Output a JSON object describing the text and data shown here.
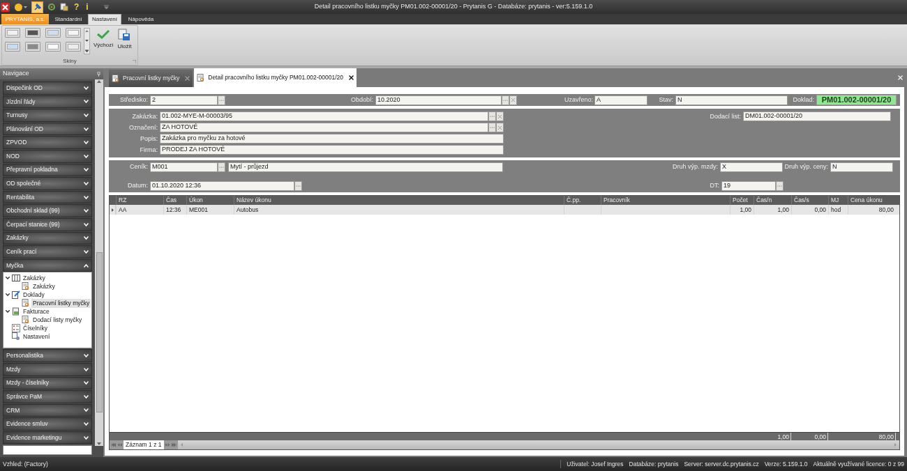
{
  "window": {
    "title": "Detail pracovního listku myčky PM01.002-00001/20 - Prytanis G - Databáze: prytanis - ver:5.159.1.0"
  },
  "quick_access": [
    {
      "kind": "close"
    },
    {
      "kind": "circle"
    },
    {
      "kind": "pin",
      "selected": true
    },
    {
      "kind": "refresh"
    },
    {
      "kind": "doc"
    },
    {
      "kind": "glyph",
      "text": "?"
    },
    {
      "kind": "glyph",
      "text": "i"
    }
  ],
  "ribbon": {
    "tabs": [
      {
        "label": "PRYTANIS, a.s.",
        "kind": "app",
        "selected": false
      },
      {
        "label": "Standardní",
        "kind": "tab",
        "selected": false
      },
      {
        "label": "Nastavení",
        "kind": "tab",
        "selected": true
      },
      {
        "label": "Nápověda",
        "kind": "tab",
        "selected": false
      }
    ],
    "group_label": "Skiny",
    "buttons": [
      {
        "label": "Výchozí",
        "kind": "check"
      },
      {
        "label": "Uložit",
        "kind": "save"
      }
    ]
  },
  "navigation": {
    "title": "Navigace",
    "groups": [
      {
        "label": "Dispečink OD",
        "expanded": false
      },
      {
        "label": "Jízdní řády",
        "expanded": false
      },
      {
        "label": "Turnusy",
        "expanded": false
      },
      {
        "label": "Plánování OD",
        "expanded": false
      },
      {
        "label": "ZPVOD",
        "expanded": false
      },
      {
        "label": "NOD",
        "expanded": false
      },
      {
        "label": "Přepravní pokladna",
        "expanded": false
      },
      {
        "label": "OD společné",
        "expanded": false
      },
      {
        "label": "Rentabilita",
        "expanded": false
      },
      {
        "label": "Obchodní sklad (99)",
        "expanded": false
      },
      {
        "label": "Čerpací stanice (99)",
        "expanded": false
      },
      {
        "label": "Zakázky",
        "expanded": false
      },
      {
        "label": "Ceník prací",
        "expanded": false
      },
      {
        "label": "Myčka",
        "expanded": true,
        "children": [
          {
            "label": "Zakázky",
            "kind": "folder",
            "expanded": true,
            "selected": false,
            "children": [
              {
                "label": "Zakázky",
                "kind": "report",
                "selected": false
              }
            ]
          },
          {
            "label": "Doklady",
            "kind": "edit",
            "expanded": true,
            "selected": false,
            "children": [
              {
                "label": "Pracovní listky myčky",
                "kind": "report",
                "selected": true
              }
            ]
          },
          {
            "label": "Fakturace",
            "kind": "invoice",
            "expanded": true,
            "selected": false,
            "children": [
              {
                "label": "Dodací listy myčky",
                "kind": "report",
                "selected": false
              }
            ]
          },
          {
            "label": "Číselníky",
            "kind": "numbers",
            "selected": false
          },
          {
            "label": "Nastavení",
            "kind": "settings",
            "selected": false
          }
        ]
      },
      {
        "label": "Personalistika",
        "expanded": false
      },
      {
        "label": "Mzdy",
        "expanded": false
      },
      {
        "label": "Mzdy - číselníky",
        "expanded": false
      },
      {
        "label": "Správce PaM",
        "expanded": false
      },
      {
        "label": "CRM",
        "expanded": false
      },
      {
        "label": "Evidence smluv",
        "expanded": false
      },
      {
        "label": "Evidence marketingu",
        "expanded": false
      }
    ]
  },
  "document_tabs": [
    {
      "label": "Pracovní listky myčky",
      "selected": false
    },
    {
      "label": "Detail pracovního listku myčky PM01.002-00001/20",
      "selected": true
    }
  ],
  "form": {
    "header": [
      {
        "label": "Středisko:",
        "value": "2"
      },
      {
        "label": "Období:",
        "value": "10.2020"
      },
      {
        "label": "Uzavřeno:",
        "value": "A"
      },
      {
        "label": "Stav:",
        "value": "N"
      },
      {
        "label": "Doklad:",
        "value": "PM01.002-00001/20"
      }
    ],
    "order": [
      {
        "label": "Zakázka:",
        "value": "01.002-MYE-M-00003/95"
      },
      {
        "label": "Označení:",
        "value": "ZA HOTOVÉ"
      },
      {
        "label": "Popis:",
        "value": "Zakázka pro myčku za hotové"
      },
      {
        "label": "Firma:",
        "value": "PRODEJ ZA HOTOVÉ"
      },
      {
        "label": "Dodací list:",
        "value": "DM01.002-00001/20"
      }
    ],
    "pricing": [
      {
        "label": "Ceník:",
        "value": "M001"
      },
      {
        "value": "Mytí - průjezd"
      },
      {
        "label": "Druh výp. mzdy:",
        "value": "X"
      },
      {
        "label": "Druh výp. ceny:",
        "value": "N"
      },
      {
        "label": "Datum:",
        "value": "01.10.2020 12:36"
      },
      {
        "label": "DT:",
        "value": "19"
      }
    ]
  },
  "grid": {
    "columns": [
      "RZ",
      "Čas",
      "Úkon",
      "Název úkonu",
      "Č.pp.",
      "Pracovník",
      "Počet",
      "Čas/n",
      "Čas/s",
      "MJ",
      "Cena úkonu"
    ],
    "rows": [
      {
        "selected": true,
        "cells": [
          "AA",
          "12:36",
          "ME001",
          "Autobus",
          "",
          "",
          "1,00",
          "1,00",
          "0,00",
          "hod",
          "80,00"
        ]
      }
    ],
    "totals": {
      "cas_n": "1,00",
      "cas_s": "0,00",
      "cena_ukonu": "80,00"
    },
    "pager": "Záznam 1 z 1"
  },
  "status_bar": {
    "left": "Vzhled: (Factory)",
    "items": [
      "Uživatel: Josef Ingres",
      "Databáze: prytanis",
      "Server: server.dc.prytanis.cz",
      "Verze: 5.159.1.0",
      "Aktuálně využívané licence: 0 z 99"
    ]
  }
}
